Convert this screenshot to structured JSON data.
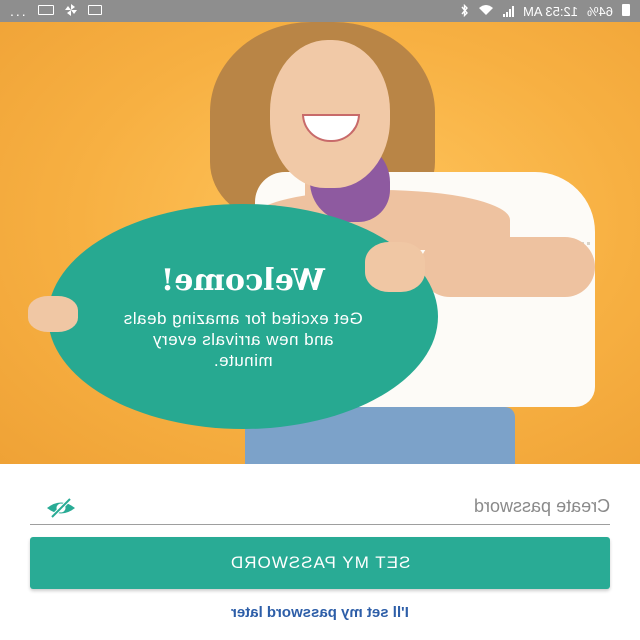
{
  "status_bar": {
    "time": "12:53 AM",
    "battery": "64%",
    "more": "...",
    "icons": [
      "picture-icon",
      "pinwheel-icon",
      "sim-card-icon",
      "bluetooth-icon",
      "wifi-icon",
      "signal-icon",
      "battery-icon"
    ]
  },
  "hero": {
    "welcome_title": "Welcome!",
    "welcome_body": "Get excited for amazing deals and new arrivals every minute.",
    "bubble_color": "#27a991",
    "background_color": "#f7b042"
  },
  "form": {
    "password_placeholder": "Create password",
    "password_value": "",
    "visibility_icon": "eye-off-icon",
    "set_password_label": "SET MY PASSWORD",
    "later_label": "I'll set my password later",
    "accent_color": "#29ab95",
    "link_color": "#2d5ea8"
  }
}
